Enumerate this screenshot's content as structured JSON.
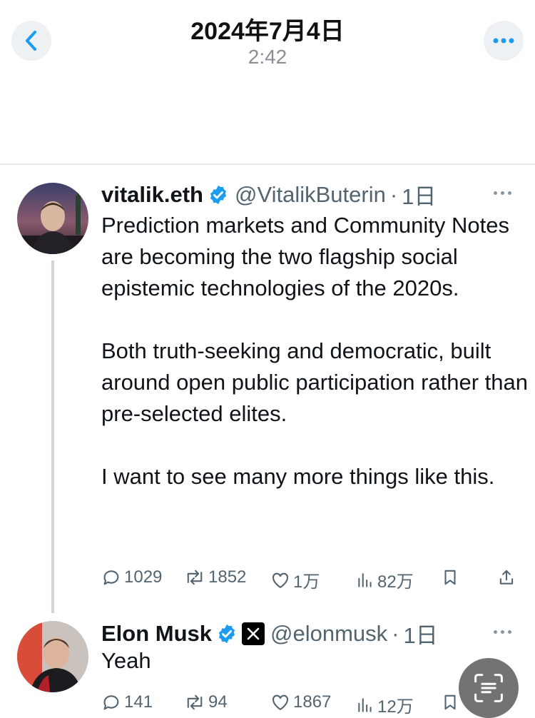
{
  "header": {
    "date": "2024年7月4日",
    "time": "2:42"
  },
  "tweets": [
    {
      "name": "vitalik.eth",
      "handle": "@VitalikButerin",
      "separator": "·",
      "time": "1日",
      "text": "Prediction markets and Community Notes are becoming the two flagship social epistemic technologies of the 2020s.\n\nBoth truth-seeking and democratic, built around open public participation rather than pre-selected elites.\n\nI want to see many more things like this.",
      "stats": {
        "replies": "1029",
        "reposts": "1852",
        "likes": "1万",
        "views": "82万"
      }
    },
    {
      "name": "Elon Musk",
      "handle": "@elonmusk",
      "separator": "·",
      "time": "1日",
      "text": "Yeah",
      "stats": {
        "replies": "141",
        "reposts": "94",
        "likes": "1867",
        "views": "12万"
      }
    }
  ],
  "icons": {
    "back": "chevron-left-icon",
    "more": "more-horizontal-icon",
    "verified": "verified-badge-icon",
    "x_badge": "x-logo-badge",
    "reply": "reply-icon",
    "repost": "repost-icon",
    "like": "heart-icon",
    "views": "views-icon",
    "bookmark": "bookmark-icon",
    "share": "share-icon",
    "scan": "scan-text-icon"
  },
  "colors": {
    "accent": "#1d9bf0",
    "secondary_text": "#536471",
    "primary_text": "#0f1419"
  }
}
